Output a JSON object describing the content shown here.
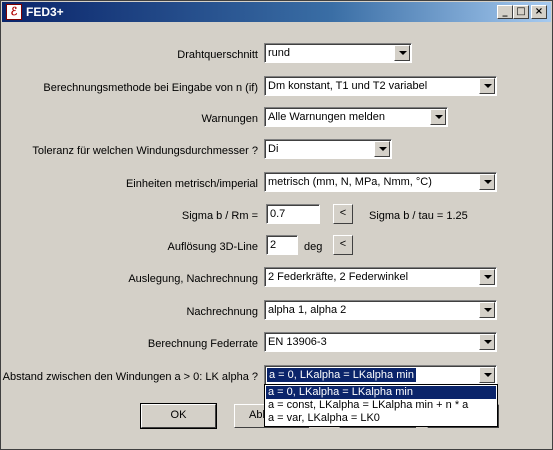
{
  "window": {
    "title": "FED3+",
    "icon": "app-icon",
    "buttons": {
      "minimize": "_",
      "maximize": "□",
      "close": "×"
    }
  },
  "fields": {
    "drahtquerschnitt": {
      "label": "Drahtquerschnitt",
      "value": "rund"
    },
    "berechnungsmethode": {
      "label": "Berechnungsmethode bei Eingabe von n (if)",
      "value": "Dm konstant, T1 und T2 variabel"
    },
    "warnungen": {
      "label": "Warnungen",
      "value": "Alle Warnungen melden"
    },
    "toleranz": {
      "label": "Toleranz für welchen Windungsdurchmesser ?",
      "value": "Di"
    },
    "einheiten": {
      "label": "Einheiten metrisch/imperial",
      "value": "metrisch (mm, N, MPa, Nmm, °C)"
    },
    "sigma": {
      "label": "Sigma b / Rm =",
      "value": "0.7",
      "button": "<",
      "info": "Sigma b / tau = 1.25"
    },
    "aufloesung": {
      "label": "Auflösung 3D-Line",
      "value": "2",
      "unit": "deg",
      "button": "<"
    },
    "auslegung": {
      "label": "Auslegung, Nachrechnung",
      "value": "2 Federkräfte, 2 Federwinkel"
    },
    "nachrechnung": {
      "label": "Nachrechnung",
      "value": "alpha 1, alpha 2"
    },
    "federrate": {
      "label": "Berechnung Federrate",
      "value": "EN 13906-3"
    },
    "abstand": {
      "label": "Abstand zwischen den Windungen a > 0: LK alpha ?",
      "value": "a = 0, LKalpha = LKalpha min",
      "options": [
        "a = 0, LKalpha = LKalpha min",
        "a = const, LKalpha = LKalpha min + n * a",
        "a = var, LKalpha = LK0"
      ],
      "selected_index": 0
    }
  },
  "buttons": {
    "ok": "OK",
    "abbrechen": "Abb"
  }
}
